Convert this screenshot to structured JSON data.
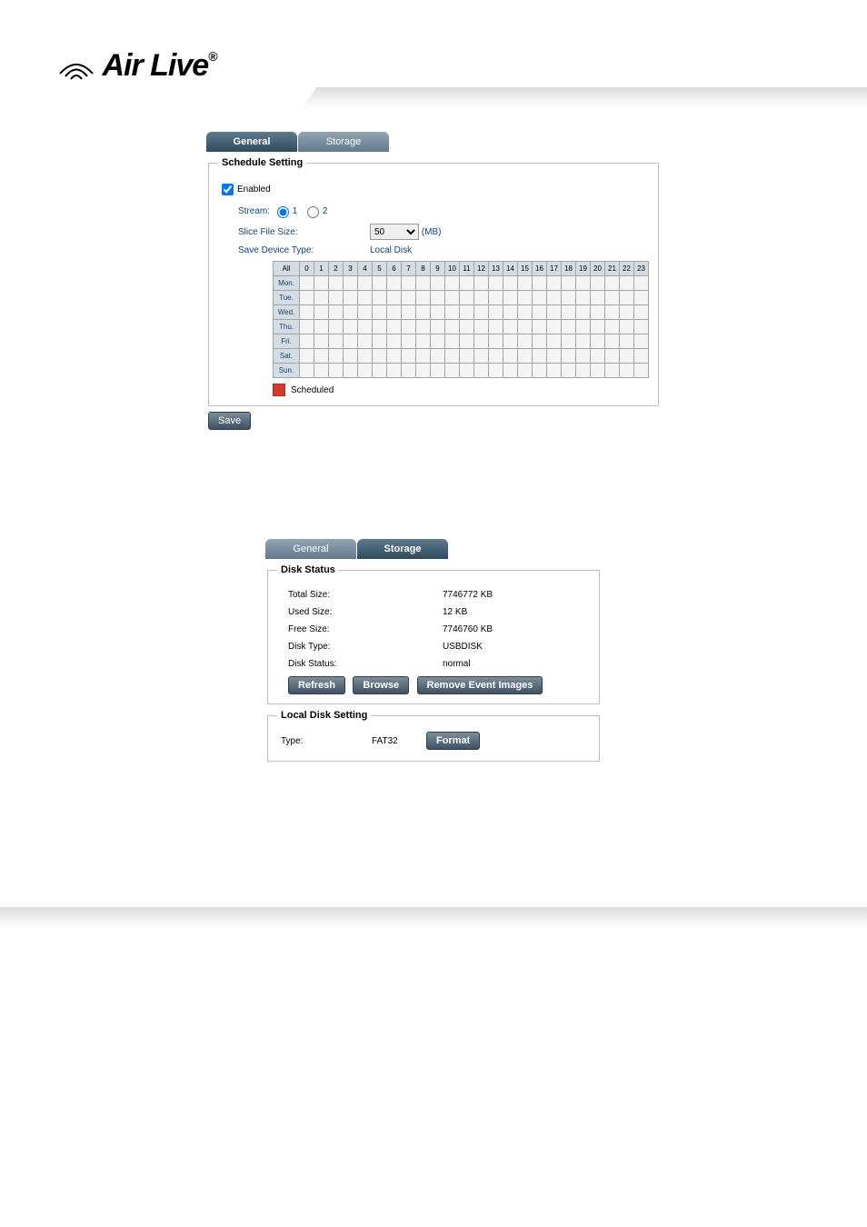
{
  "brand": {
    "name": "Air Live",
    "reg": "®"
  },
  "panel1": {
    "tabs": {
      "general": "General",
      "storage": "Storage"
    },
    "legend": "Schedule Setting",
    "enabled_label": "Enabled",
    "enabled_checked": true,
    "stream_label": "Stream:",
    "stream_opt1": "1",
    "stream_opt2": "2",
    "slice_label": "Slice File Size:",
    "slice_value": "50",
    "slice_unit": "(MB)",
    "save_type_label": "Save Device Type:",
    "save_type_value": "Local Disk",
    "hours": [
      "All",
      "0",
      "1",
      "2",
      "3",
      "4",
      "5",
      "6",
      "7",
      "8",
      "9",
      "10",
      "11",
      "12",
      "13",
      "14",
      "15",
      "16",
      "17",
      "18",
      "19",
      "20",
      "21",
      "22",
      "23"
    ],
    "days": [
      "Mon.",
      "Tue.",
      "Wed.",
      "Thu.",
      "Fri.",
      "Sat.",
      "Sun."
    ],
    "scheduled_legend": "Scheduled",
    "save_btn": "Save"
  },
  "panel2": {
    "tabs": {
      "general": "General",
      "storage": "Storage"
    },
    "disk_status_legend": "Disk Status",
    "total_size_label": "Total Size:",
    "total_size_value": "7746772 KB",
    "used_size_label": "Used Size:",
    "used_size_value": "12 KB",
    "free_size_label": "Free Size:",
    "free_size_value": "7746760 KB",
    "disk_type_label": "Disk Type:",
    "disk_type_value": "USBDISK",
    "disk_status_label": "Disk Status:",
    "disk_status_value": "normal",
    "refresh_btn": "Refresh",
    "browse_btn": "Browse",
    "remove_btn": "Remove Event Images",
    "local_disk_legend": "Local Disk Setting",
    "lds_type_label": "Type:",
    "lds_type_value": "FAT32",
    "format_btn": "Format"
  }
}
